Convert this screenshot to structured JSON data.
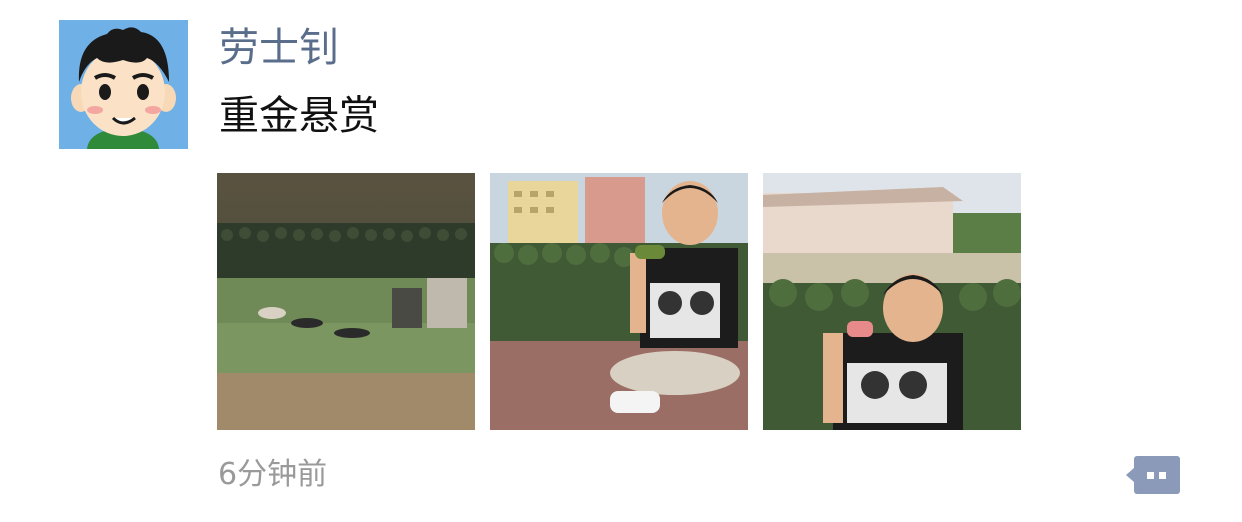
{
  "post": {
    "username": "劳士钊",
    "text": "重金悬赏",
    "timestamp": "6分钟前"
  },
  "avatar": {
    "icon": "cartoon-boy-avatar",
    "background_color": "#6fb0e6"
  },
  "photos": [
    {
      "icon": "military-training-field-photo"
    },
    {
      "icon": "man-sitting-with-microphone-photo"
    },
    {
      "icon": "man-with-microphone-closeup-photo"
    }
  ],
  "colors": {
    "username": "#5a6e8c",
    "timestamp": "#9a9a9a",
    "comment_button": "#8a9ab8"
  },
  "comment_button": {
    "icon": "comment-dots-icon"
  }
}
